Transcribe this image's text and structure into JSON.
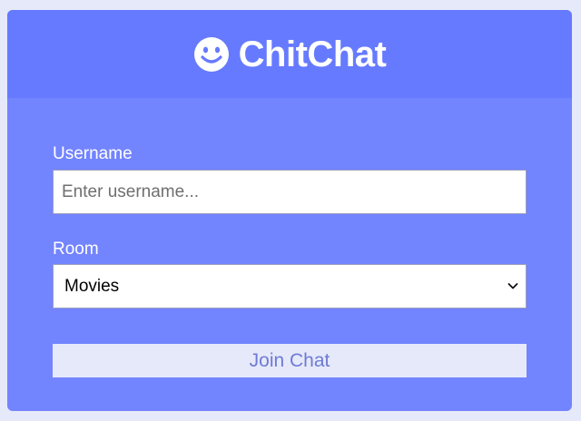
{
  "app": {
    "title": "ChitChat",
    "logo_icon": "smiley-face-icon"
  },
  "form": {
    "username": {
      "label": "Username",
      "placeholder": "Enter username...",
      "value": ""
    },
    "room": {
      "label": "Room",
      "selected": "Movies"
    },
    "join_button_label": "Join Chat"
  },
  "colors": {
    "page_background": "#e6e9f9",
    "header_background": "#667aff",
    "card_background": "#7384ff",
    "button_background": "#e6e9fa",
    "button_text": "#6e7bd6"
  }
}
